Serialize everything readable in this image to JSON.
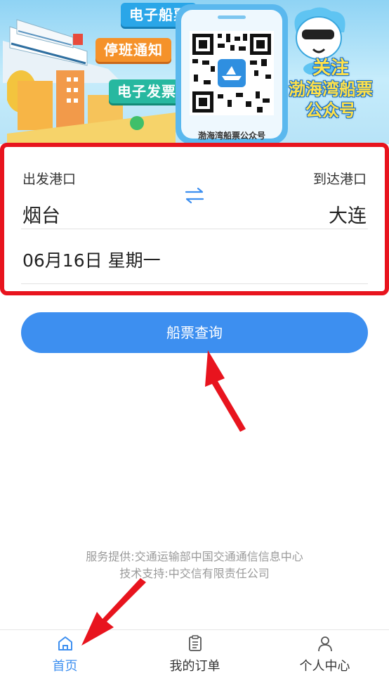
{
  "banner": {
    "badge_ticket": "电子船票",
    "badge_notice": "停班通知",
    "badge_invoice": "电子发票",
    "qr_caption": "渤海湾船票公众号",
    "follow_line1": "关注",
    "follow_line2": "渤海湾船票",
    "follow_line3": "公众号"
  },
  "query": {
    "from_label": "出发港口",
    "to_label": "到达港口",
    "from_value": "烟台",
    "to_value": "大连",
    "date": "06月16日 星期一"
  },
  "search_button": "船票查询",
  "footer": {
    "provider": "服务提供:交通运输部中国交通通信信息中心",
    "support": "技术支持:中交信有限责任公司"
  },
  "tabbar": {
    "items": [
      {
        "label": "首页",
        "icon": "home-icon",
        "active": true
      },
      {
        "label": "我的订单",
        "icon": "order-list-icon",
        "active": false
      },
      {
        "label": "个人中心",
        "icon": "user-icon",
        "active": false
      }
    ]
  },
  "colors": {
    "accent": "#3d8ff0",
    "highlight_border": "#e8141e",
    "annotation_arrow": "#e8141e"
  }
}
